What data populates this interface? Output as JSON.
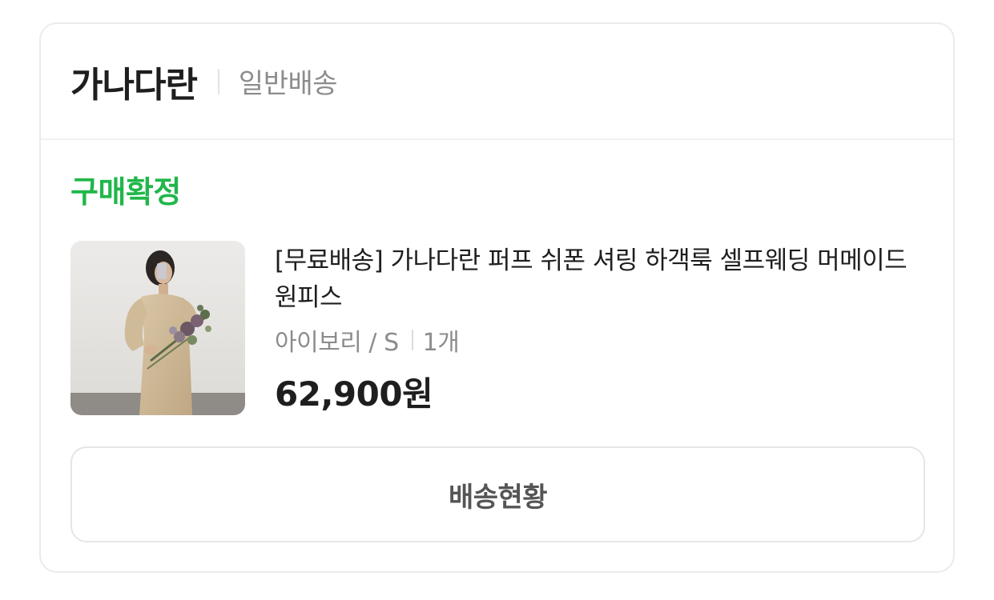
{
  "seller": {
    "name": "가나다란",
    "shipping_type": "일반배송"
  },
  "order": {
    "status": "구매확정",
    "status_color": "#20b74a"
  },
  "product": {
    "title": "[무료배송] 가나다란 퍼프 쉬폰 셔링 하객룩 셀프웨딩 머메이드 원피스",
    "option": "아이보리 / S",
    "quantity": "1개",
    "price": "62,900원",
    "image": "product-photo-beige-dress-with-bouquet"
  },
  "actions": {
    "track_label": "배송현황"
  }
}
